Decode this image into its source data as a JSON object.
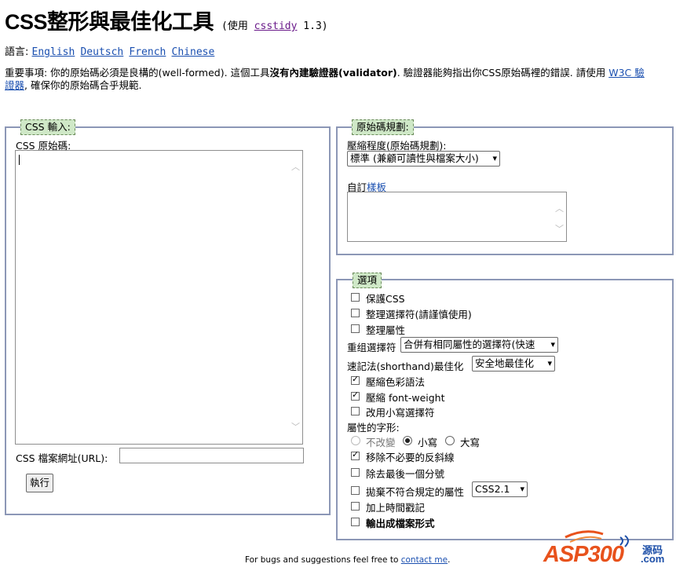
{
  "header": {
    "title": "CSS整形與最佳化工具",
    "subtitle_prefix": "(使用",
    "subtitle_link": "csstidy",
    "subtitle_version": "1.3)"
  },
  "languages": {
    "label": "語言:",
    "items": [
      "English",
      "Deutsch",
      "French",
      "Chinese"
    ]
  },
  "notice": {
    "part1": "重要事項: 你的原始碼必須是良構的(well-formed). 這個工具",
    "bold": "沒有內建驗證器(validator)",
    "part2": ". 驗證器能夠指出你CSS原始碼裡的錯誤. 請使用",
    "link1": "W3C 驗",
    "link2": "證器",
    "part3": ", 確保你的原始碼合乎規範."
  },
  "input_panel": {
    "legend": "CSS 輸入:",
    "source_label": "CSS 原始碼:",
    "url_label": "CSS 檔案網址(URL):",
    "url_value": "",
    "submit_label": "執行"
  },
  "template_panel": {
    "legend": "原始碼規劃:",
    "compression_label": "壓縮程度(原始碼規劃):",
    "compression_value": "標準 (兼顧可讀性與檔案大小)",
    "custom_label": "自訂",
    "custom_link": "樣板"
  },
  "options_panel": {
    "legend": "選項",
    "preserve_css": {
      "label": "保護CSS",
      "checked": false
    },
    "sort_selectors": {
      "label": "整理選擇符(請謹慎使用)",
      "checked": false
    },
    "sort_properties": {
      "label": "整理屬性",
      "checked": false
    },
    "regroup_label": "重组選擇符",
    "regroup_value": "合併有相同屬性的選擇符(快速",
    "shorthand_label": "速記法(shorthand)最佳化",
    "shorthand_value": "安全地最佳化",
    "compress_colors": {
      "label": "壓縮色彩語法",
      "checked": true
    },
    "compress_font_weight": {
      "label": "壓縮 font-weight",
      "checked": true
    },
    "lowercase_selectors": {
      "label": "改用小寫選擇符",
      "checked": false
    },
    "case_label": "屬性的字形:",
    "case_none": "不改變",
    "case_lower": "小寫",
    "case_upper": "大寫",
    "remove_backslash": {
      "label": "移除不必要的反斜線",
      "checked": true
    },
    "remove_last_semicolon": {
      "label": "除去最後一個分號",
      "checked": false
    },
    "discard_invalid": {
      "label": "拋棄不符合規定的屬性",
      "checked": false
    },
    "css_level_value": "CSS2.1",
    "timestamp": {
      "label": "加上時間戳記",
      "checked": false
    },
    "output_file": {
      "label": "輸出成檔案形式",
      "checked": false
    }
  },
  "footer": {
    "text": "For bugs and suggestions feel free to",
    "link": "contact me",
    "end": "."
  },
  "watermark": {
    "brand": "ASP300",
    "suffix_top": "源码",
    "suffix_bottom": ".com"
  },
  "colors": {
    "link": "#1a4fb0",
    "visited_link": "#6a1a8a",
    "fieldset_border": "#8c97b6",
    "legend_bg": "#cfe8c7",
    "watermark_orange": "#e8521c",
    "watermark_blue": "#1d4fa8"
  }
}
